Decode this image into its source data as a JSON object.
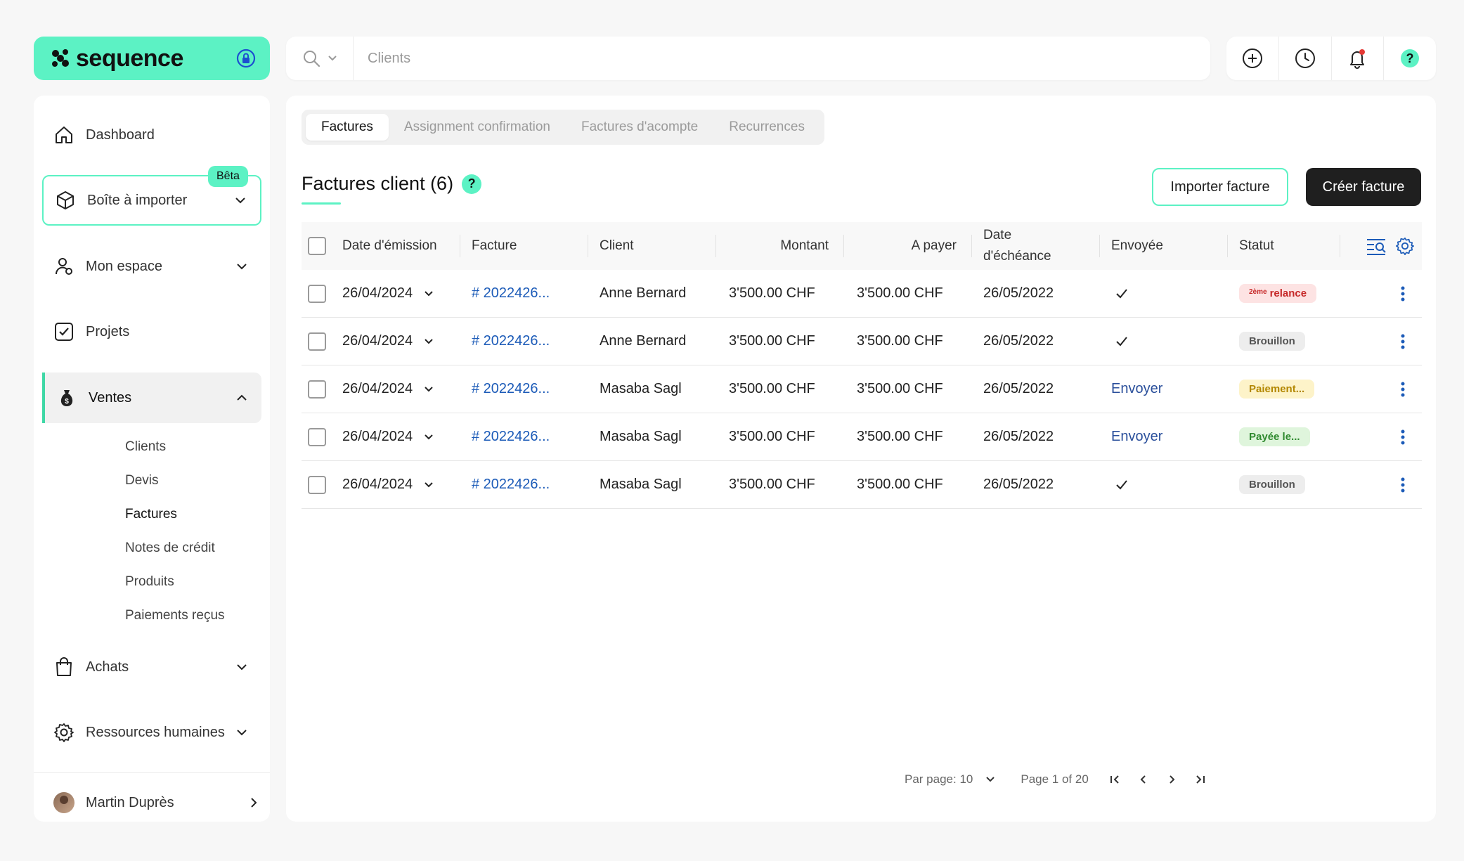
{
  "app": {
    "brand": "sequence",
    "colors": {
      "accent": "#5cf2c4",
      "link": "#1c5bb8",
      "dark_button": "#1f1f1f"
    }
  },
  "search": {
    "placeholder": "Clients",
    "value": ""
  },
  "top_actions": [
    {
      "icon": "plus-circle-icon"
    },
    {
      "icon": "clock-icon"
    },
    {
      "icon": "bell-icon",
      "has_notification": true
    },
    {
      "icon": "help-icon"
    }
  ],
  "sidebar": {
    "items": [
      {
        "label": "Dashboard",
        "icon": "home-icon"
      },
      {
        "label": "Boîte à importer",
        "icon": "box-icon",
        "badge": "Bêta"
      },
      {
        "label": "Mon espace",
        "icon": "user-space-icon"
      },
      {
        "label": "Projets",
        "icon": "checkbox-icon"
      },
      {
        "label": "Ventes",
        "icon": "money-bag-icon",
        "expanded": true
      },
      {
        "label": "Achats",
        "icon": "shopping-bag-icon"
      },
      {
        "label": "Ressources humaines",
        "icon": "gear-icon"
      }
    ],
    "sub_items": [
      "Clients",
      "Devis",
      "Factures",
      "Notes de crédit",
      "Produits",
      "Paiements reçus"
    ],
    "active_sub_item": "Factures",
    "user": {
      "name": "Martin Duprès"
    }
  },
  "main": {
    "tabs": [
      "Factures",
      "Assignment confirmation",
      "Factures d'acompte",
      "Recurrences"
    ],
    "active_tab": "Factures",
    "title": "Factures client (6)",
    "help": "?",
    "buttons": {
      "import": "Importer facture",
      "create": "Créer facture"
    },
    "table": {
      "headers": {
        "date": "Date d'émission",
        "invoice": "Facture",
        "client": "Client",
        "amount": "Montant",
        "to_pay": "A payer",
        "due_line1": "Date",
        "due_line2": "d'échéance",
        "sent": "Envoyée",
        "status": "Statut"
      },
      "rows": [
        {
          "date": "26/04/2024",
          "invoice": "# 2022426...",
          "client": "Anne Bernard",
          "amount": "3'500.00 CHF",
          "to_pay": "3'500.00 CHF",
          "due": "26/05/2022",
          "sent": "✓",
          "status_sup": "2ème",
          "status": "relance",
          "status_type": "relance"
        },
        {
          "date": "26/04/2024",
          "invoice": "# 2022426...",
          "client": "Anne Bernard",
          "amount": "3'500.00 CHF",
          "to_pay": "3'500.00 CHF",
          "due": "26/05/2022",
          "sent": "✓",
          "status_sup": "",
          "status": "Brouillon",
          "status_type": "draft"
        },
        {
          "date": "26/04/2024",
          "invoice": "# 2022426...",
          "client": "Masaba Sagl",
          "amount": "3'500.00 CHF",
          "to_pay": "3'500.00 CHF",
          "due": "26/05/2022",
          "sent": "Envoyer",
          "status_sup": "",
          "status": "Paiement...",
          "status_type": "payment"
        },
        {
          "date": "26/04/2024",
          "invoice": "# 2022426...",
          "client": "Masaba Sagl",
          "amount": "3'500.00 CHF",
          "to_pay": "3'500.00 CHF",
          "due": "26/05/2022",
          "sent": "Envoyer",
          "status_sup": "",
          "status": "Payée le...",
          "status_type": "paid"
        },
        {
          "date": "26/04/2024",
          "invoice": "# 2022426...",
          "client": "Masaba Sagl",
          "amount": "3'500.00 CHF",
          "to_pay": "3'500.00 CHF",
          "due": "26/05/2022",
          "sent": "✓",
          "status_sup": "",
          "status": "Brouillon",
          "status_type": "draft"
        }
      ]
    },
    "pagination": {
      "per_page_label": "Par page: 10",
      "page_label": "Page 1 of 20"
    }
  }
}
